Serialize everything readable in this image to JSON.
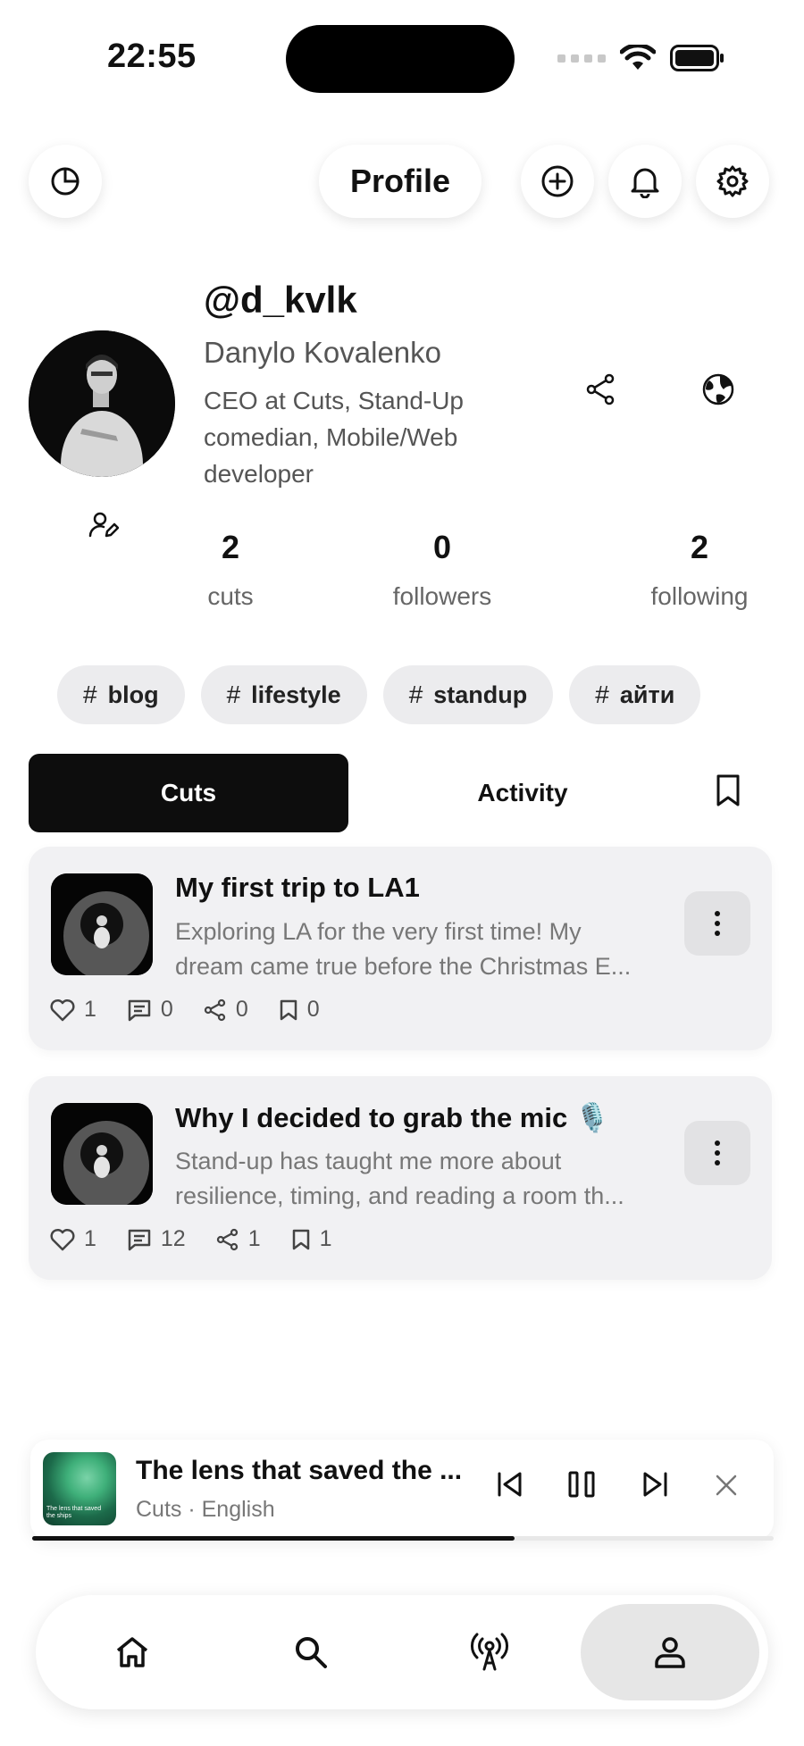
{
  "status_bar": {
    "time": "22:55"
  },
  "header": {
    "title": "Profile"
  },
  "profile": {
    "handle": "@d_kvlk",
    "name": "Danylo Kovalenko",
    "bio": "CEO at Cuts, Stand-Up comedian, Mobile/Web developer",
    "stats": [
      {
        "value": "2",
        "label": "cuts"
      },
      {
        "value": "0",
        "label": "followers"
      },
      {
        "value": "2",
        "label": "following"
      }
    ]
  },
  "tags": [
    {
      "hash": "#",
      "label": "blog"
    },
    {
      "hash": "#",
      "label": "lifestyle"
    },
    {
      "hash": "#",
      "label": "standup"
    },
    {
      "hash": "#",
      "label": "айти"
    }
  ],
  "tabs": {
    "active": "Cuts",
    "other": "Activity"
  },
  "posts": [
    {
      "title": "My first trip to LA1",
      "desc_line1": "Exploring LA for the very first time! My",
      "desc_line2": "dream came true before the Christmas E...",
      "likes": "1",
      "comments": "0",
      "shares": "0",
      "saves": "0"
    },
    {
      "title": "Why I decided to grab the mic 🎙️",
      "desc_line1": "Stand-up has taught me more about",
      "desc_line2": "resilience, timing, and reading a room th...",
      "likes": "1",
      "comments": "12",
      "shares": "1",
      "saves": "1"
    }
  ],
  "player": {
    "title": "The lens that saved the ...",
    "subtitle": "Cuts · English",
    "art_caption": "The lens that saved the ships",
    "progress": 0.65
  },
  "colors": {
    "accent": "#0d0d0d",
    "card_bg": "#f1f1f3",
    "tag_bg": "#ececee"
  },
  "icons": {
    "header_left": "history-icon",
    "header_actions": [
      "add-circle-icon",
      "bell-icon",
      "gear-icon"
    ],
    "profile_actions": [
      "share-icon",
      "globe-icon",
      "edit-profile-icon"
    ],
    "nav": [
      "home-icon",
      "search-icon",
      "broadcast-icon",
      "user-icon"
    ]
  }
}
